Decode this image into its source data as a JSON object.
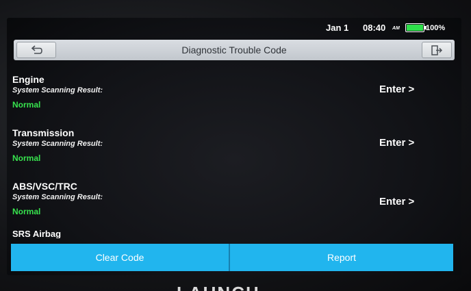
{
  "status_bar": {
    "date": "Jan 1",
    "time": "08:40",
    "ampm": "AM",
    "battery": "100%",
    "battery_level": 1.0,
    "battery_color": "#2ee04b"
  },
  "header": {
    "title": "Diagnostic Trouble Code",
    "back_icon": "back-arrow-icon",
    "exit_icon": "exit-icon"
  },
  "systems": [
    {
      "name": "Engine",
      "scan_label": "System Scanning Result:",
      "status": "Normal",
      "enter_label": "Enter >"
    },
    {
      "name": "Transmission",
      "scan_label": "System Scanning Result:",
      "status": "Normal",
      "enter_label": "Enter >"
    },
    {
      "name": "ABS/VSC/TRC",
      "scan_label": "System Scanning Result:",
      "status": "Normal",
      "enter_label": "Enter >"
    }
  ],
  "partial_item": "SRS Airbag",
  "actions": {
    "clear_code": "Clear Code",
    "report": "Report"
  },
  "colors": {
    "status_normal": "#37e34e",
    "action_bar": "#21b5ee"
  },
  "brand": "LAUNCH"
}
